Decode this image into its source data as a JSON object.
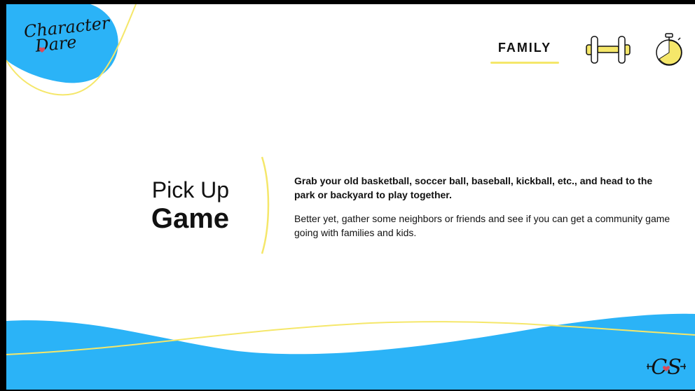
{
  "logo": {
    "line1": "Character",
    "line2": "Dare"
  },
  "header": {
    "category": "FAMILY"
  },
  "icons": {
    "dumbbell": "dumbbell-icon",
    "stopwatch": "stopwatch-icon",
    "heart": "heart-icon"
  },
  "title": {
    "line1": "Pick Up",
    "line2": "Game"
  },
  "description": {
    "bold": "Grab your old basketball, soccer ball, baseball, kickball, etc., and head to the park or backyard to play together.",
    "body": "Better yet, gather some neighbors or friends and see if you can get a community game going with families and kids."
  },
  "footer_logo": {
    "text": "CS"
  },
  "colors": {
    "blue": "#2bb3f7",
    "yellow": "#f5e76a",
    "heart": "#d94a5a",
    "text": "#111111",
    "background": "#ffffff"
  }
}
